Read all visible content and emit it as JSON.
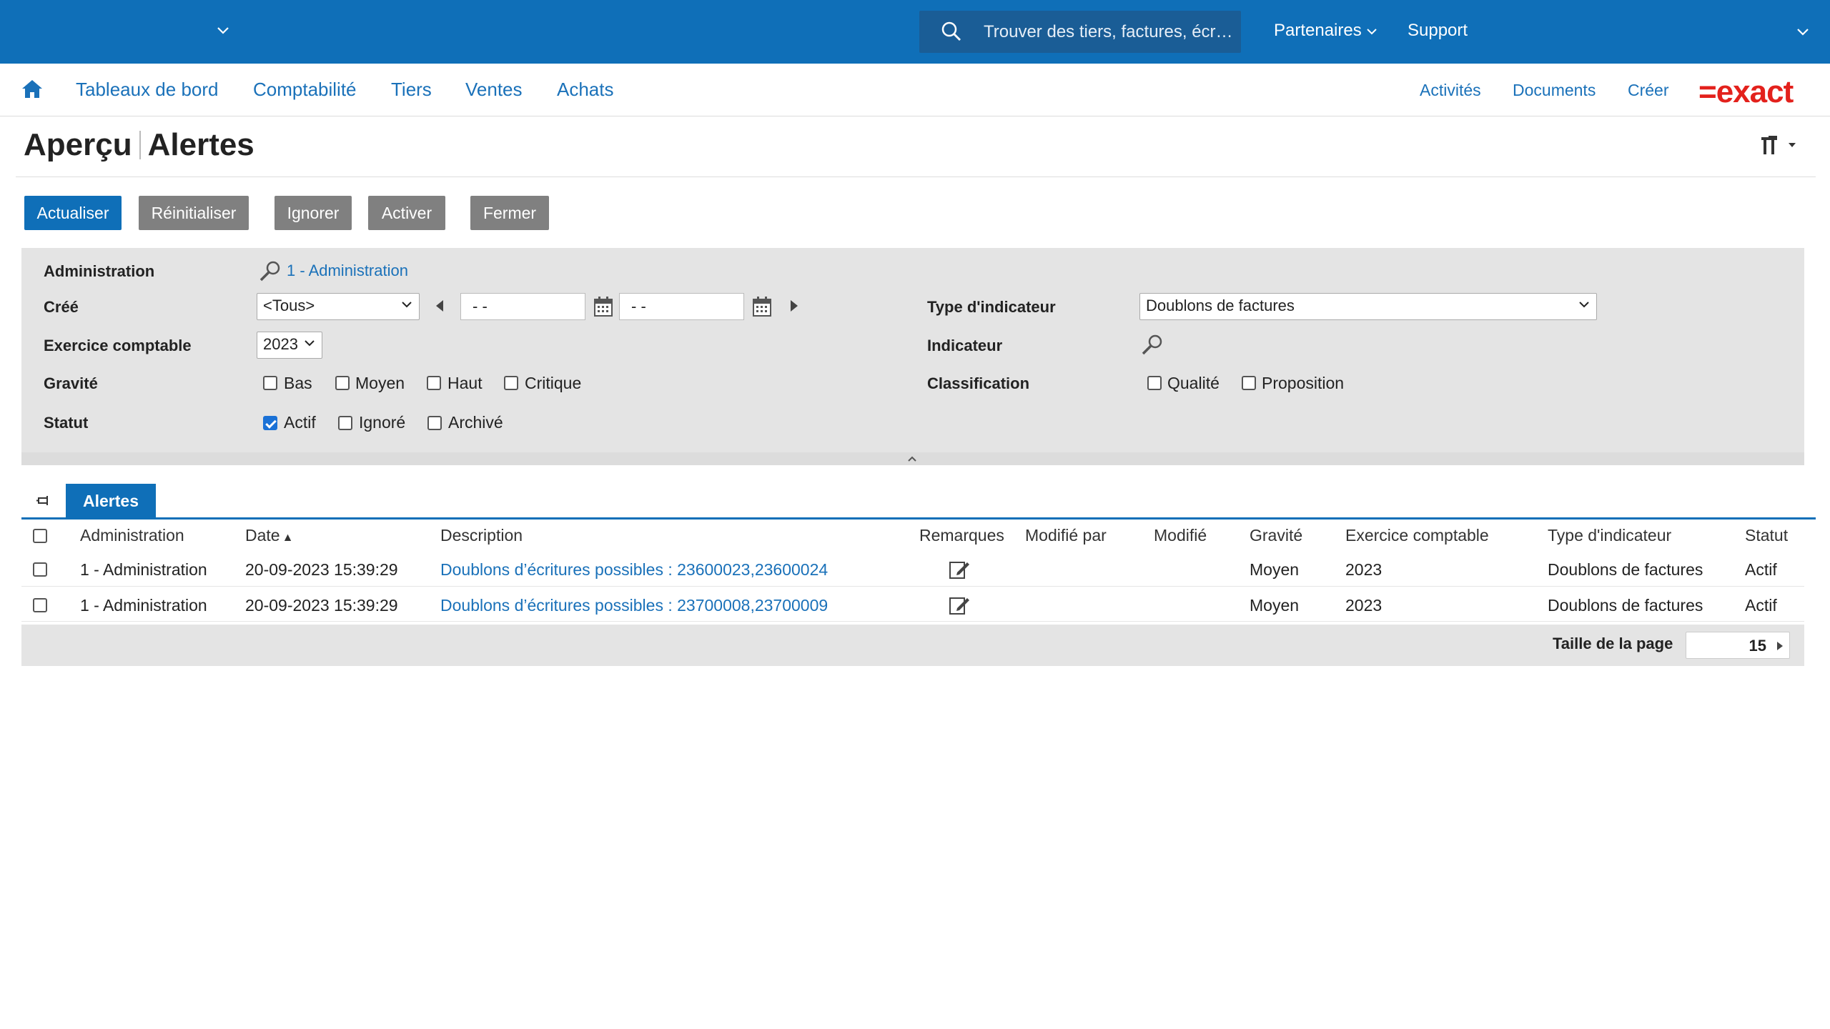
{
  "topbar": {
    "search_placeholder": "Trouver des tiers, factures, écr…",
    "partners": "Partenaires",
    "support": "Support",
    "bg_color": "#0f6fb8"
  },
  "nav": {
    "items": [
      "Tableaux de bord",
      "Comptabilité",
      "Tiers",
      "Ventes",
      "Achats"
    ],
    "right": [
      "Activités",
      "Documents",
      "Créer"
    ],
    "logo": "=exact"
  },
  "page": {
    "title_left": "Aperçu",
    "title_right": "Alertes"
  },
  "toolbar": {
    "refresh": "Actualiser",
    "reset": "Réinitialiser",
    "ignore": "Ignorer",
    "activate": "Activer",
    "close": "Fermer"
  },
  "filters": {
    "administration_label": "Administration",
    "administration_value": "1 - Administration",
    "created_label": "Créé",
    "created_value": "<Tous>",
    "date_from": "- -",
    "date_to": "- -",
    "fiscal_year_label": "Exercice comptable",
    "fiscal_year_value": "2023",
    "severity_label": "Gravité",
    "severity_options": [
      {
        "label": "Bas",
        "checked": false
      },
      {
        "label": "Moyen",
        "checked": false
      },
      {
        "label": "Haut",
        "checked": false
      },
      {
        "label": "Critique",
        "checked": false
      }
    ],
    "status_label": "Statut",
    "status_options": [
      {
        "label": "Actif",
        "checked": true
      },
      {
        "label": "Ignoré",
        "checked": false
      },
      {
        "label": "Archivé",
        "checked": false
      }
    ],
    "indicator_type_label": "Type d'indicateur",
    "indicator_type_value": "Doublons de factures",
    "indicator_label": "Indicateur",
    "classification_label": "Classification",
    "classification_options": [
      {
        "label": "Qualité",
        "checked": false
      },
      {
        "label": "Proposition",
        "checked": false
      }
    ]
  },
  "tabs": {
    "alerts": "Alertes"
  },
  "table": {
    "columns": [
      "Administration",
      "Date",
      "Description",
      "Remarques",
      "Modifié par",
      "Modifié",
      "Gravité",
      "Exercice comptable",
      "Type d'indicateur",
      "Statut"
    ],
    "sort_indicator": "▲",
    "rows": [
      {
        "administration": "1 - Administration",
        "date": "20-09-2023 15:39:29",
        "description": "Doublons d’écritures possibles : 23600023,23600024",
        "modified_by": "",
        "modified": "",
        "severity": "Moyen",
        "fiscal_year": "2023",
        "indicator_type": "Doublons de factures",
        "status": "Actif"
      },
      {
        "administration": "1 - Administration",
        "date": "20-09-2023 15:39:29",
        "description": "Doublons d’écritures possibles : 23700008,23700009",
        "modified_by": "",
        "modified": "",
        "severity": "Moyen",
        "fiscal_year": "2023",
        "indicator_type": "Doublons de factures",
        "status": "Actif"
      }
    ],
    "page_size_label": "Taille de la page",
    "page_size_value": "15"
  }
}
